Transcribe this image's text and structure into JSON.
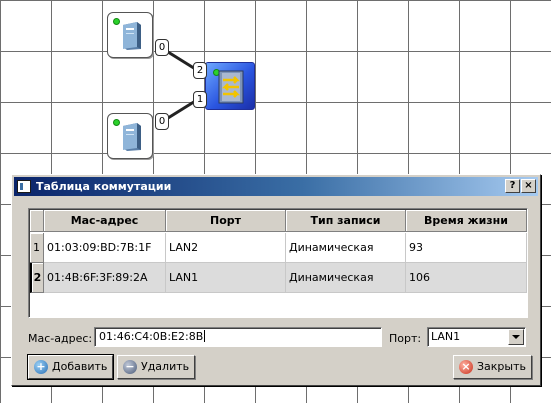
{
  "network": {
    "ports": {
      "pc_top": "0",
      "pc_bottom": "0",
      "switch_to_top": "2",
      "switch_to_bottom": "1"
    },
    "led_color": "#2bd12b"
  },
  "dialog": {
    "title": "Таблица коммутации",
    "help_button": "?",
    "close_button": "×",
    "table": {
      "columns": [
        "Mac-адрес",
        "Порт",
        "Тип записи",
        "Время жизни"
      ],
      "rows": [
        {
          "num": "1",
          "mac": "01:03:09:BD:7B:1F",
          "port": "LAN2",
          "type": "Динамическая",
          "ttl": "93"
        },
        {
          "num": "2",
          "mac": "01:4B:6F:3F:89:2A",
          "port": "LAN1",
          "type": "Динамическая",
          "ttl": "106"
        }
      ]
    },
    "form": {
      "mac_label": "Mac-адрес:",
      "mac_value": "01:46:C4:0B:E2:8B",
      "port_label": "Порт:",
      "port_value": "LAN1"
    },
    "buttons": {
      "add": "Добавить",
      "remove": "Удалить",
      "close": "Закрыть"
    }
  }
}
